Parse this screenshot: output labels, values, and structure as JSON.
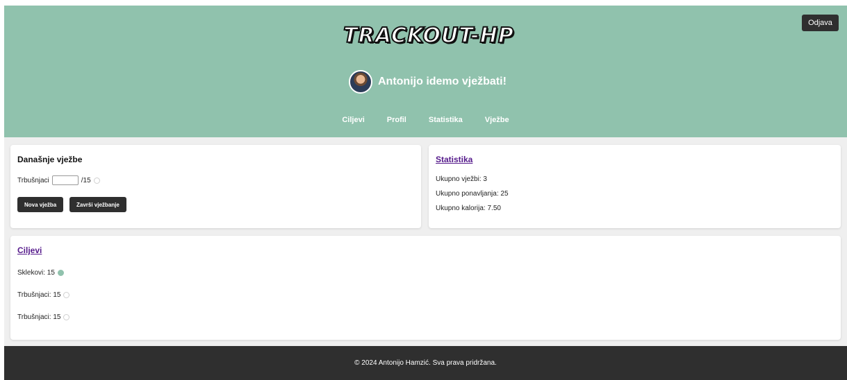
{
  "header": {
    "logo_text": "TRACKOUT-HP",
    "logout_label": "Odjava",
    "welcome": "Antonijo idemo vježbati!",
    "nav": [
      "Ciljevi",
      "Profil",
      "Statistika",
      "Vježbe"
    ],
    "accent_color": "#90c2ad"
  },
  "today": {
    "title": "Današnje vježbe",
    "exercise_name": "Trbušnjaci",
    "input_value": "",
    "target": "/15",
    "new_exercise_label": "Nova vježba",
    "finish_label": "Završi vježbanje"
  },
  "stats": {
    "title": "Statistika",
    "total_exercises": "Ukupno vježbi: 3",
    "total_reps": "Ukupno ponavljanja: 25",
    "total_calories": "Ukupno kalorija: 7.50"
  },
  "goals": {
    "title": "Ciljevi",
    "items": [
      {
        "label": "Sklekovi: 15",
        "done": true
      },
      {
        "label": "Trbušnjaci: 15",
        "done": false
      },
      {
        "label": "Trbušnjaci: 15",
        "done": false
      }
    ]
  },
  "footer": {
    "text": "© 2024 Antonijo Hamzić. Sva prava pridržana."
  }
}
